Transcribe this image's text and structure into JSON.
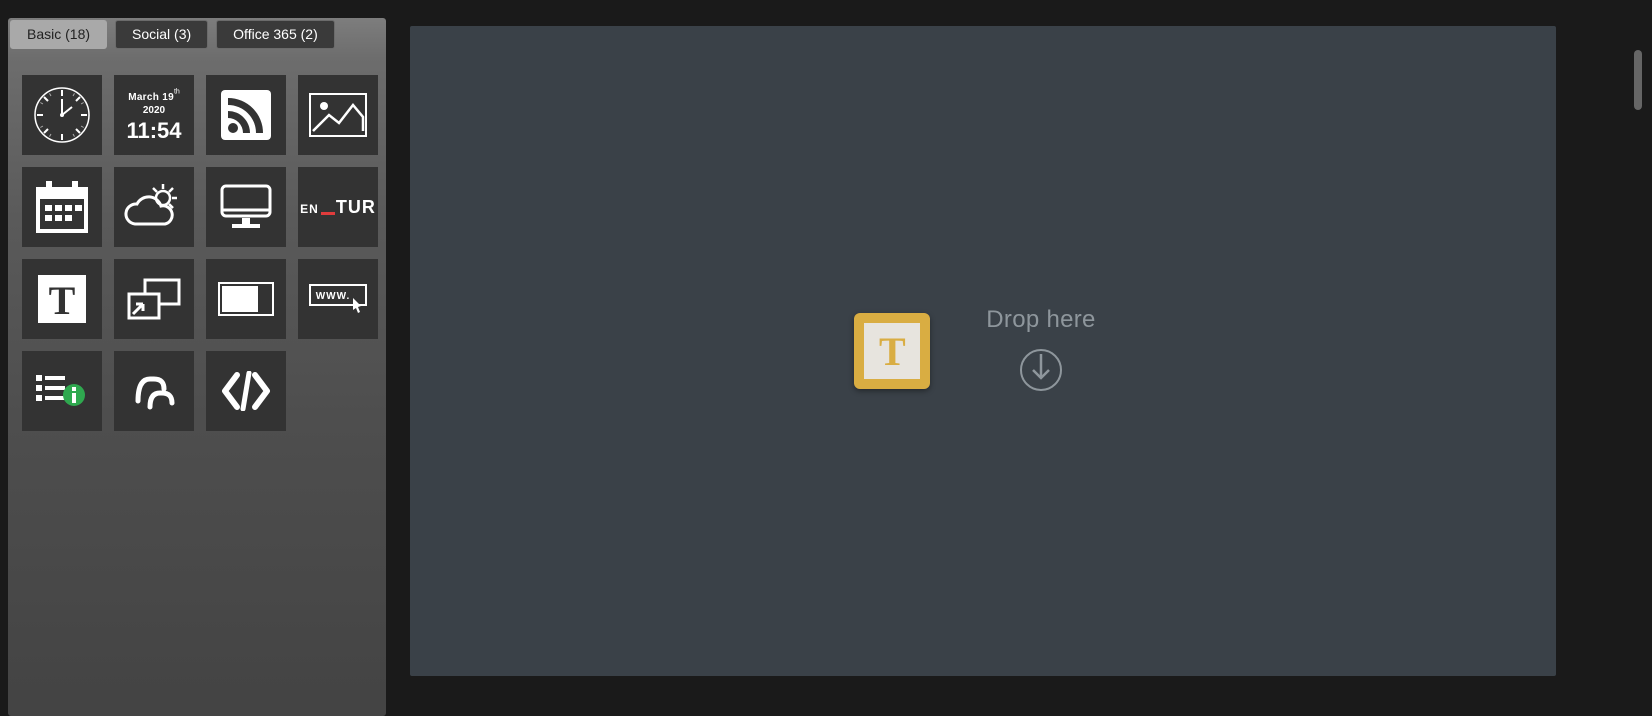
{
  "tabs": [
    {
      "label": "Basic (18)",
      "active": true
    },
    {
      "label": "Social (3)",
      "active": false
    },
    {
      "label": "Office 365 (2)",
      "active": false
    }
  ],
  "date_tile": {
    "month_day": "March 19",
    "ordinal": "th",
    "year": "2020",
    "time": "11:54"
  },
  "entur": {
    "en": "EN",
    "tur": "TUR"
  },
  "drop": {
    "label": "Drop here"
  },
  "drag_preview_letter": "T"
}
